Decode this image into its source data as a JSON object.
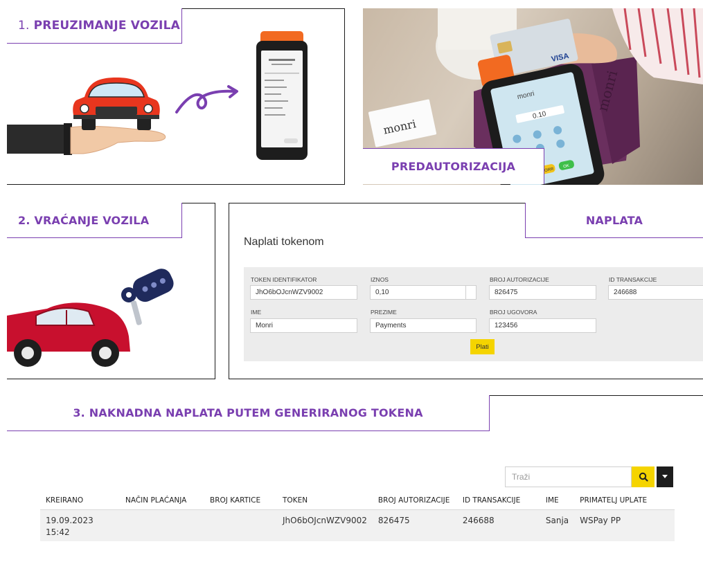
{
  "section1": {
    "number": "1.",
    "title": "PREUZIMANJE VOZILA"
  },
  "photo_caption": "PREDAUTORIZACIJA",
  "section2": {
    "title": "2. VRAĆANJE VOZILA"
  },
  "naplata": {
    "tag": "NAPLATA",
    "form_title": "Naplati tokenom",
    "fields": {
      "token_label": "TOKEN IDENTIFIKATOR",
      "token_value": "JhO6bOJcnWZV9002",
      "iznos_label": "IZNOS",
      "iznos_value": "0,10",
      "auth_label": "BROJ AUTORIZACIJE",
      "auth_value": "826475",
      "trans_label": "ID TRANSAKCIJE",
      "trans_value": "246688",
      "ime_label": "IME",
      "ime_value": "Monri",
      "prezime_label": "PREZIME",
      "prezime_value": "Payments",
      "ugovor_label": "BROJ UGOVORA",
      "ugovor_value": "123456"
    },
    "submit": "Plati"
  },
  "section3": {
    "title": "3. NAKNADNA NAPLATA PUTEM GENERIRANOG TOKENA"
  },
  "search": {
    "placeholder": "Traži"
  },
  "table": {
    "headers": [
      "KREIRANO",
      "NAČIN PLAĆANJA",
      "BROJ KARTICE",
      "TOKEN",
      "BROJ AUTORIZACIJE",
      "ID TRANSAKCIJE",
      "IME",
      "PRIMATELJ UPLATE"
    ],
    "rows": [
      [
        "19.09.2023 15:42",
        "",
        "",
        "JhO6bOJcnWZV9002",
        "826475",
        "246688",
        "Sanja",
        "WSPay PP"
      ]
    ]
  },
  "illustration_text": {
    "pos_logo": "monri",
    "pos_amount": "0.10",
    "pos_key_corr": "CORR",
    "pos_key_ok": "OK",
    "card_brand": "VISA"
  },
  "colors": {
    "accent_purple": "#7a3fb0",
    "button_yellow": "#f5d400",
    "car_orange": "#e8361e",
    "car_red": "#c8102e",
    "pos_orange": "#f26a21"
  }
}
